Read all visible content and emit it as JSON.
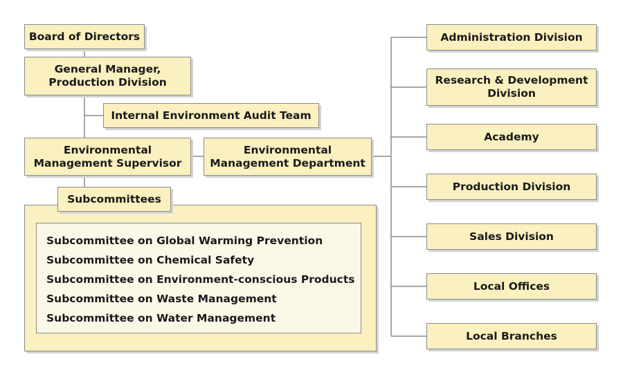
{
  "board": "Board of Directors",
  "general_manager": [
    "General Manager,",
    "Production Division"
  ],
  "audit_team": "Internal Environment Audit Team",
  "supervisor": [
    "Environmental",
    "Management Supervisor"
  ],
  "department": [
    "Environmental",
    "Management Department"
  ],
  "subcommittees": {
    "title": "Subcommittees",
    "items": [
      "Subcommittee on Global Warming Prevention",
      "Subcommittee on Chemical Safety",
      "Subcommittee on Environment-conscious Products",
      "Subcommittee on Waste Management",
      "Subcommittee on Water Management"
    ]
  },
  "divisions": [
    [
      "Administration Division"
    ],
    [
      "Research & Development",
      "Division"
    ],
    [
      "Academy"
    ],
    [
      "Production Division"
    ],
    [
      "Sales Division"
    ],
    [
      "Local Offices"
    ],
    [
      "Local Branches"
    ]
  ],
  "colors": {
    "box_fill": "#fbf0bf",
    "inner_fill": "#fcf8e8",
    "border": "#8a8a8a",
    "connector": "#8a8a8a"
  }
}
